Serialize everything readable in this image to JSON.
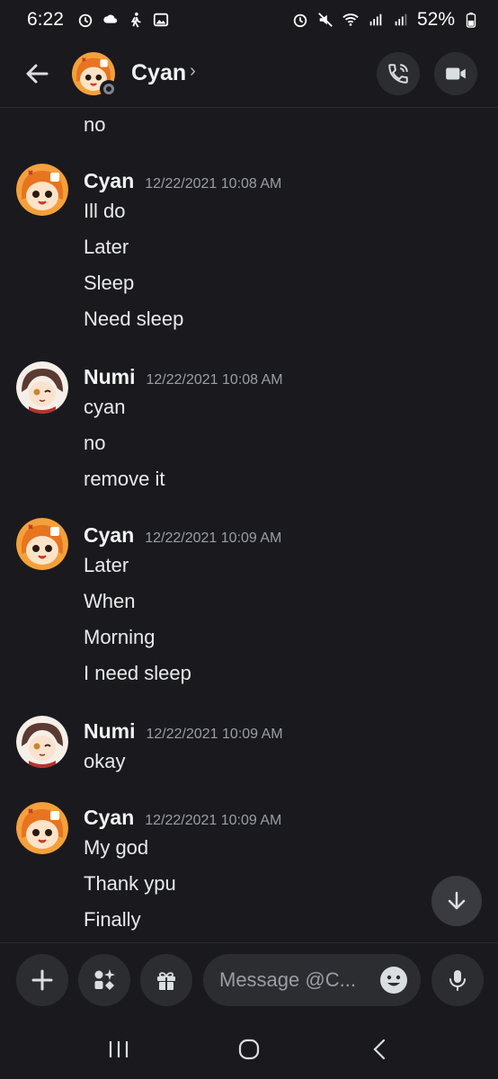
{
  "status_bar": {
    "time": "6:22",
    "battery": "52%"
  },
  "header": {
    "name": "Cyan",
    "chevron": "›"
  },
  "messages": [
    {
      "type": "line",
      "text": "no"
    },
    {
      "type": "group",
      "author": "Cyan",
      "timestamp": "12/22/2021 10:08 AM",
      "avatar": "cyan",
      "lines": [
        "Ill do",
        "Later",
        "Sleep",
        "Need sleep"
      ]
    },
    {
      "type": "group",
      "author": "Numi",
      "timestamp": "12/22/2021 10:08 AM",
      "avatar": "numi",
      "lines": [
        "cyan",
        "no",
        "remove it"
      ]
    },
    {
      "type": "group",
      "author": "Cyan",
      "timestamp": "12/22/2021 10:09 AM",
      "avatar": "cyan",
      "lines": [
        "Later",
        "When",
        "Morning",
        "I need sleep"
      ]
    },
    {
      "type": "group",
      "author": "Numi",
      "timestamp": "12/22/2021 10:09 AM",
      "avatar": "numi",
      "lines": [
        "okay"
      ]
    },
    {
      "type": "group",
      "author": "Cyan",
      "timestamp": "12/22/2021 10:09 AM",
      "avatar": "cyan",
      "lines": [
        "My god",
        "Thank ypu",
        "Finally"
      ]
    }
  ],
  "composer": {
    "placeholder": "Message @C..."
  },
  "icons": {
    "back": "arrow-left-icon",
    "call": "phone-icon",
    "video": "video-camera-icon",
    "scroll_down": "arrow-down-icon",
    "plus": "plus-icon",
    "apps": "apps-sparkle-icon",
    "gift": "gift-icon",
    "emoji": "emoji-icon",
    "mic": "microphone-icon"
  },
  "colors": {
    "background": "#1a1a1e",
    "surface": "#2b2d31",
    "text": "#f2f3f5",
    "muted": "#9b9da3",
    "cyan_avatar": "#f4a03b",
    "numi_avatar": "#5a3a32"
  }
}
